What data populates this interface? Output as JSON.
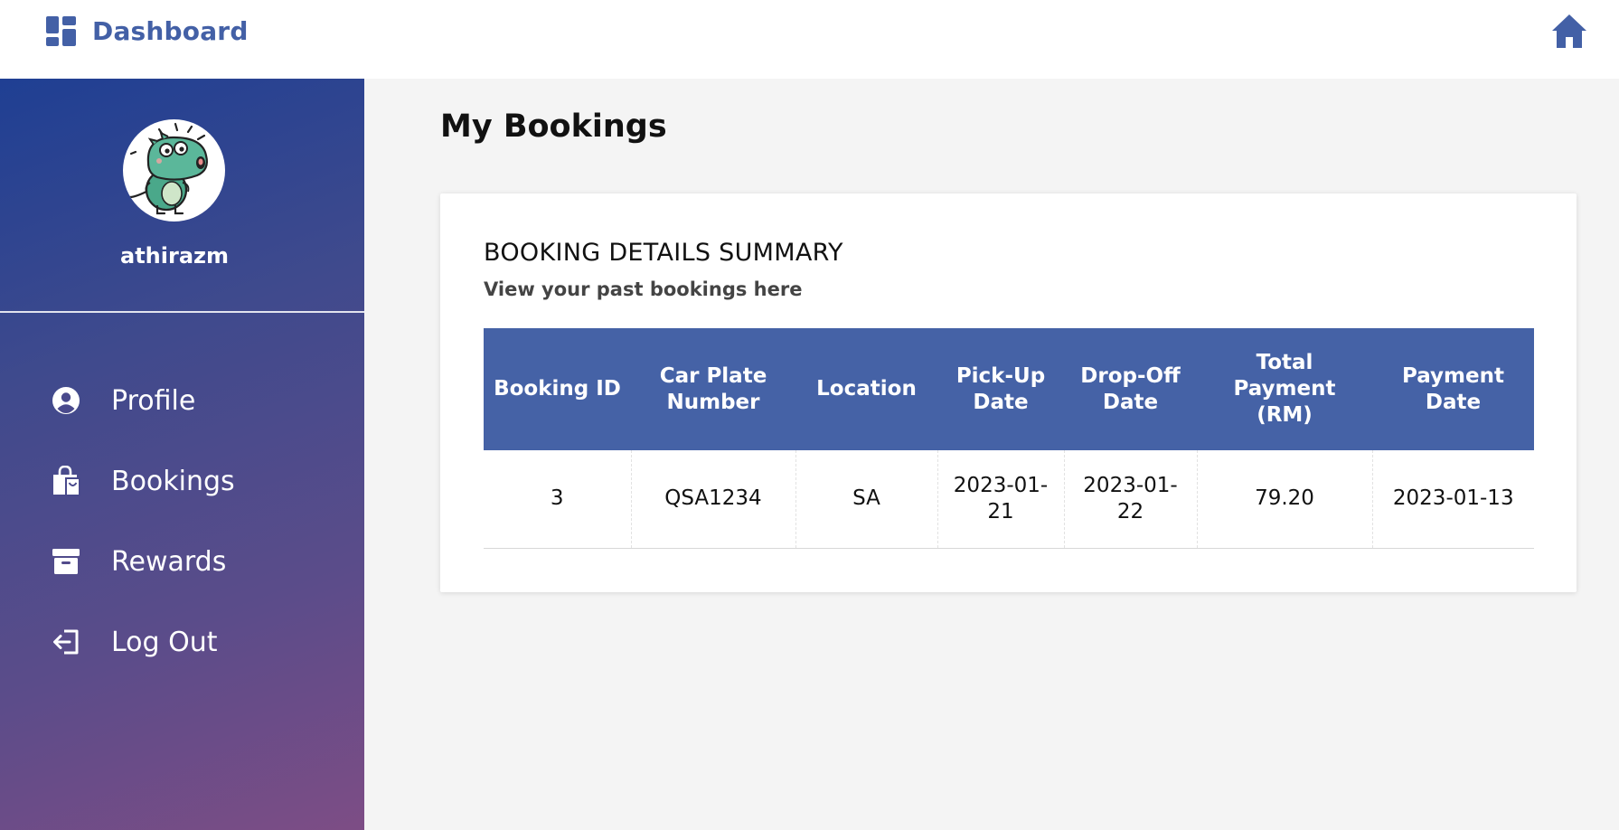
{
  "header": {
    "title": "Dashboard",
    "brand_icon": "dashboard-grid-icon",
    "home_icon": "home-icon",
    "accent_color": "#4360a6"
  },
  "sidebar": {
    "username": "athirazm",
    "avatar": "dinosaur-avatar",
    "gradient": [
      "#1f3f93",
      "#7d4d85"
    ],
    "items": [
      {
        "label": "Profile",
        "icon": "user-circle-icon"
      },
      {
        "label": "Bookings",
        "icon": "shopping-bag-icon"
      },
      {
        "label": "Rewards",
        "icon": "archive-box-icon"
      },
      {
        "label": "Log Out",
        "icon": "logout-icon"
      }
    ]
  },
  "main": {
    "page_title": "My Bookings",
    "card": {
      "title": "BOOKING DETAILS SUMMARY",
      "subtitle": "View your past bookings here",
      "table": {
        "header_color": "#4562a6",
        "columns": [
          "Booking ID",
          "Car Plate Number",
          "Location",
          "Pick-Up Date",
          "Drop-Off Date",
          "Total Payment (RM)",
          "Payment Date"
        ],
        "rows": [
          [
            "3",
            "QSA1234",
            "SA",
            "2023-01-21",
            "2023-01-22",
            "79.20",
            "2023-01-13"
          ]
        ]
      }
    }
  }
}
